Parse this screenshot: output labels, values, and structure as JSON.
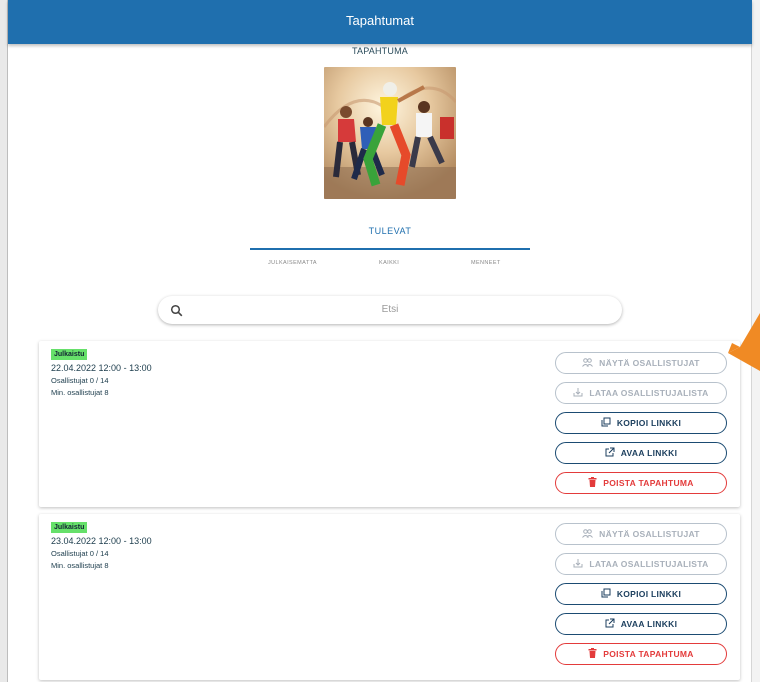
{
  "header": {
    "title": "Tapahtumat"
  },
  "event": {
    "label": "TAPAHTUMA"
  },
  "tabs": {
    "active": "TULEVAT",
    "sub": [
      "JULKAISEMATTA",
      "KAIKKI",
      "MENNEET"
    ]
  },
  "search": {
    "placeholder": "Etsi"
  },
  "occurrences": [
    {
      "status": "Julkaistu",
      "datetime": "22.04.2022 12:00 - 13:00",
      "participants": "Osallistujat 0 / 14",
      "min_participants": "Min. osallistujat 8",
      "buttons": {
        "show": "NÄYTÄ OSALLISTUJAT",
        "download": "LATAA OSALLISTUJALISTA",
        "copy": "KOPIOI LINKKI",
        "open": "AVAA LINKKI",
        "delete": "POISTA TAPAHTUMA"
      }
    },
    {
      "status": "Julkaistu",
      "datetime": "23.04.2022 12:00 - 13:00",
      "participants": "Osallistujat 0 / 14",
      "min_participants": "Min. osallistujat 8",
      "buttons": {
        "show": "NÄYTÄ OSALLISTUJAT",
        "download": "LATAA OSALLISTUJALISTA",
        "copy": "KOPIOI LINKKI",
        "open": "AVAA LINKKI",
        "delete": "POISTA TAPAHTUMA"
      }
    }
  ],
  "colors": {
    "header": "#1f6fae",
    "badge": "#66e06a",
    "delete": "#e33b3b",
    "action": "#1b4b72",
    "arrow": "#f08a24"
  }
}
